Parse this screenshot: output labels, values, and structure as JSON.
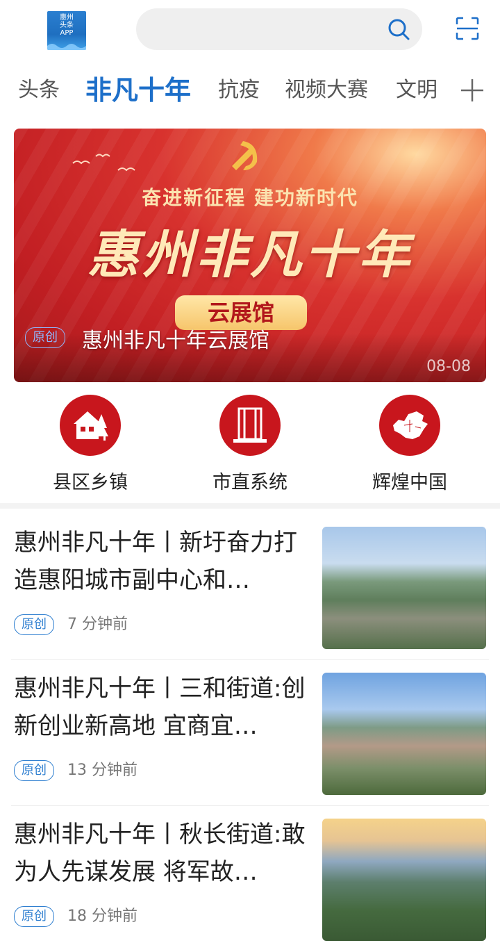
{
  "header": {
    "logo_lines": [
      "惠州",
      "头条",
      "APP"
    ],
    "search_placeholder": ""
  },
  "tabs": [
    {
      "label": "头条",
      "active": false
    },
    {
      "label": "非凡十年",
      "active": true
    },
    {
      "label": "抗疫",
      "active": false
    },
    {
      "label": "视频大赛",
      "active": false
    },
    {
      "label": "文明",
      "active": false
    }
  ],
  "banner": {
    "slogan": "奋进新征程  建功新时代",
    "headline": "惠州非凡十年",
    "hall_label": "云展馆",
    "badge": "原创",
    "caption": "惠州非凡十年云展馆",
    "date": "08-08"
  },
  "shortcuts": [
    {
      "label": "县区乡镇",
      "icon": "house-tree-icon"
    },
    {
      "label": "市直系统",
      "icon": "building-icon"
    },
    {
      "label": "辉煌中国",
      "icon": "china-map-icon"
    }
  ],
  "news": [
    {
      "title": "惠州非凡十年丨新圩奋力打造惠阳城市副中心和…",
      "badge": "原创",
      "time": "7 分钟前"
    },
    {
      "title": "惠州非凡十年丨三和街道:创新创业新高地 宜商宜…",
      "badge": "原创",
      "time": "13 分钟前"
    },
    {
      "title": "惠州非凡十年丨秋长街道:敢为人先谋发展 将军故…",
      "badge": "原创",
      "time": "18 分钟前"
    }
  ],
  "colors": {
    "accent": "#1d6fc9",
    "brand_red": "#c8161d",
    "badge_blue": "#2f7fd0"
  }
}
